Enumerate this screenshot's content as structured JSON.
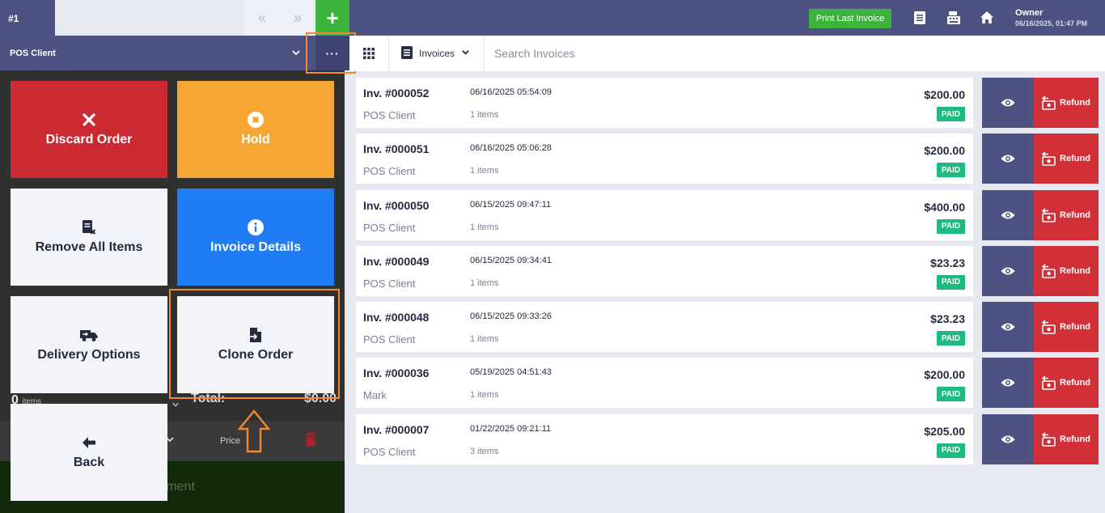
{
  "topbar": {
    "tab_label": "#1",
    "prev_icon": "«",
    "next_icon": "»",
    "add_icon": "+",
    "print_label": "Print Last Invoice",
    "user_name": "Owner",
    "user_datetime": "06/16/2025, 01:47 PM"
  },
  "client": {
    "name": "POS Client",
    "more_label": "···"
  },
  "actions": {
    "discard": "Discard Order",
    "hold": "Hold",
    "remove_all": "Remove All Items",
    "invoice_details": "Invoice Details",
    "delivery": "Delivery Options",
    "clone": "Clone Order",
    "back": "Back"
  },
  "cart_behind": {
    "count": "0",
    "items_word": "items",
    "total_label": "Total:",
    "total_value": "$0.00",
    "price_label": "Price",
    "payment_label": "rment"
  },
  "toolbar": {
    "invoices_label": "Invoices",
    "search_placeholder": "Search Invoices"
  },
  "invoices": [
    {
      "number": "Inv. #000052",
      "date": "06/16/2025  05:54:09",
      "client": "POS Client",
      "items": "1 items",
      "amount": "$200.00",
      "status": "PAID",
      "refund_label": "Refund"
    },
    {
      "number": "Inv. #000051",
      "date": "06/16/2025  05:06:28",
      "client": "POS Client",
      "items": "1 items",
      "amount": "$200.00",
      "status": "PAID",
      "refund_label": "Refund"
    },
    {
      "number": "Inv. #000050",
      "date": "06/15/2025  09:47:11",
      "client": "POS Client",
      "items": "1 items",
      "amount": "$400.00",
      "status": "PAID",
      "refund_label": "Refund"
    },
    {
      "number": "Inv. #000049",
      "date": "06/15/2025  09:34:41",
      "client": "POS Client",
      "items": "1 items",
      "amount": "$23.23",
      "status": "PAID",
      "refund_label": "Refund"
    },
    {
      "number": "Inv. #000048",
      "date": "06/15/2025  09:33:26",
      "client": "POS Client",
      "items": "1 items",
      "amount": "$23.23",
      "status": "PAID",
      "refund_label": "Refund"
    },
    {
      "number": "Inv. #000036",
      "date": "05/19/2025  04:51:43",
      "client": "Mark",
      "items": "1 items",
      "amount": "$200.00",
      "status": "PAID",
      "refund_label": "Refund"
    },
    {
      "number": "Inv. #000007",
      "date": "01/22/2025  09:21:11",
      "client": "POS Client",
      "items": "3 items",
      "amount": "$205.00",
      "status": "PAID",
      "refund_label": "Refund"
    }
  ],
  "colors": {
    "primary": "#4e5282",
    "success": "#3cb43c",
    "danger": "#cc2a32",
    "warning": "#f6a733",
    "info": "#1f7cf3",
    "paid": "#1dbb7f",
    "highlight": "#f08a2c"
  }
}
